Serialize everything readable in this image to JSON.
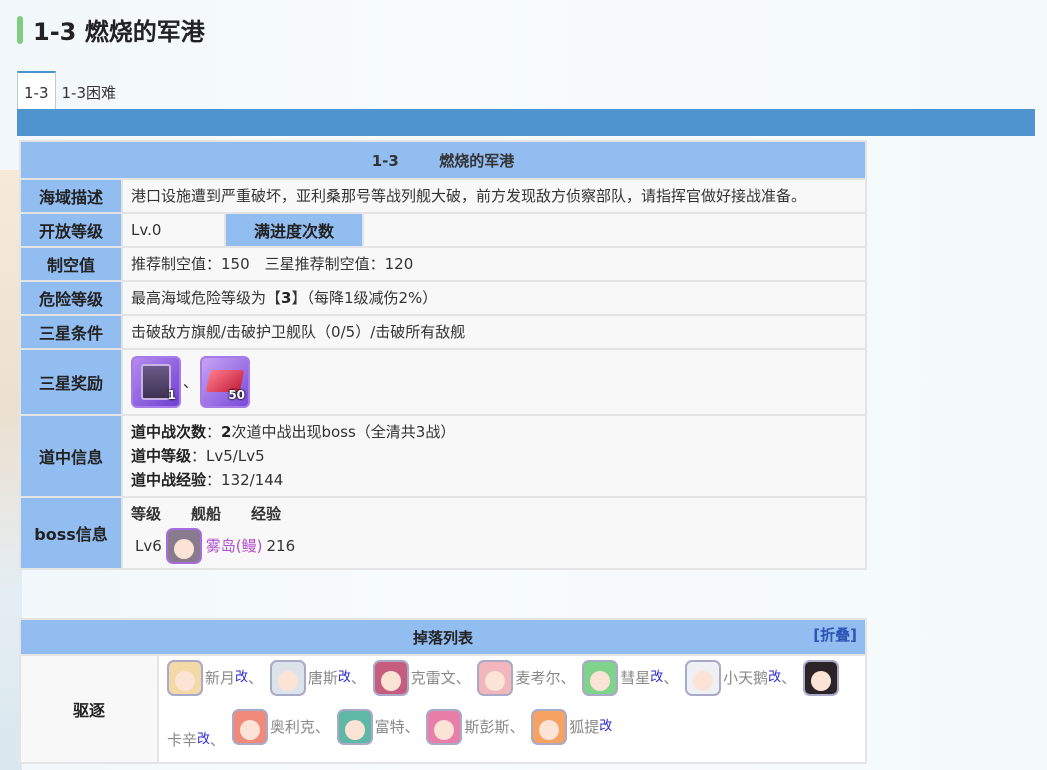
{
  "page_title": "1-3 燃烧的军港",
  "tabs": [
    "1-3",
    "1-3困难"
  ],
  "info": {
    "header_code": "1-3",
    "header_name": "燃烧的军港",
    "sea_label": "海域描述",
    "sea_desc": "港口设施遭到严重破坏，亚利桑那号等战列舰大破，前方发现敌方侦察部队，请指挥官做好接战准备。",
    "open_label": "开放等级",
    "open_value": "Lv.0",
    "progress_label": "满进度次数",
    "air_label": "制空值",
    "air_value": "推荐制空值：150　三星推荐制空值：120",
    "danger_label": "危险等级",
    "danger_prefix": "最高海域危险等级为【",
    "danger_value": "3",
    "danger_suffix": "】（每降1级减伤2%）",
    "star_cond_label": "三星条件",
    "star_cond_value": "击破敌方旗舰/击破护卫舰队（0/5）/击破所有敌舰",
    "star_reward_label": "三星奖励",
    "reward_sep": "、",
    "rewards": [
      {
        "icon": "gear-box-icon",
        "count": "1"
      },
      {
        "icon": "ruby-gem-icon",
        "count": "50"
      }
    ],
    "route_label": "道中信息",
    "route_battles_key": "道中战次数",
    "route_battles_num": "2",
    "route_battles_rest": "次道中战出现boss（全清共3战）",
    "route_level_key": "道中等级",
    "route_level_val": "Lv5/Lv5",
    "route_exp_key": "道中战经验",
    "route_exp_val": "132/144",
    "colon": "：",
    "boss_label": "boss信息",
    "boss_cols": [
      "等级",
      "舰船",
      "经验"
    ],
    "boss_level": "Lv6",
    "boss_ship": "雾岛(鳗)",
    "boss_exp": "216"
  },
  "drops": {
    "title": "掉落列表",
    "fold": "[折叠]",
    "label": "驱逐",
    "kai": "改",
    "sep": "、",
    "ships": [
      {
        "name": "新月",
        "kai": true
      },
      {
        "name": "唐斯",
        "kai": true
      },
      {
        "name": "克雷文",
        "kai": false
      },
      {
        "name": "麦考尔",
        "kai": false
      },
      {
        "name": "彗星",
        "kai": true
      },
      {
        "name": "小天鹅",
        "kai": true
      },
      {
        "name": "卡辛",
        "kai": true
      },
      {
        "name": "奥利克",
        "kai": false
      },
      {
        "name": "富特",
        "kai": false
      },
      {
        "name": "斯彭斯",
        "kai": false
      },
      {
        "name": "狐提",
        "kai": true
      }
    ]
  }
}
